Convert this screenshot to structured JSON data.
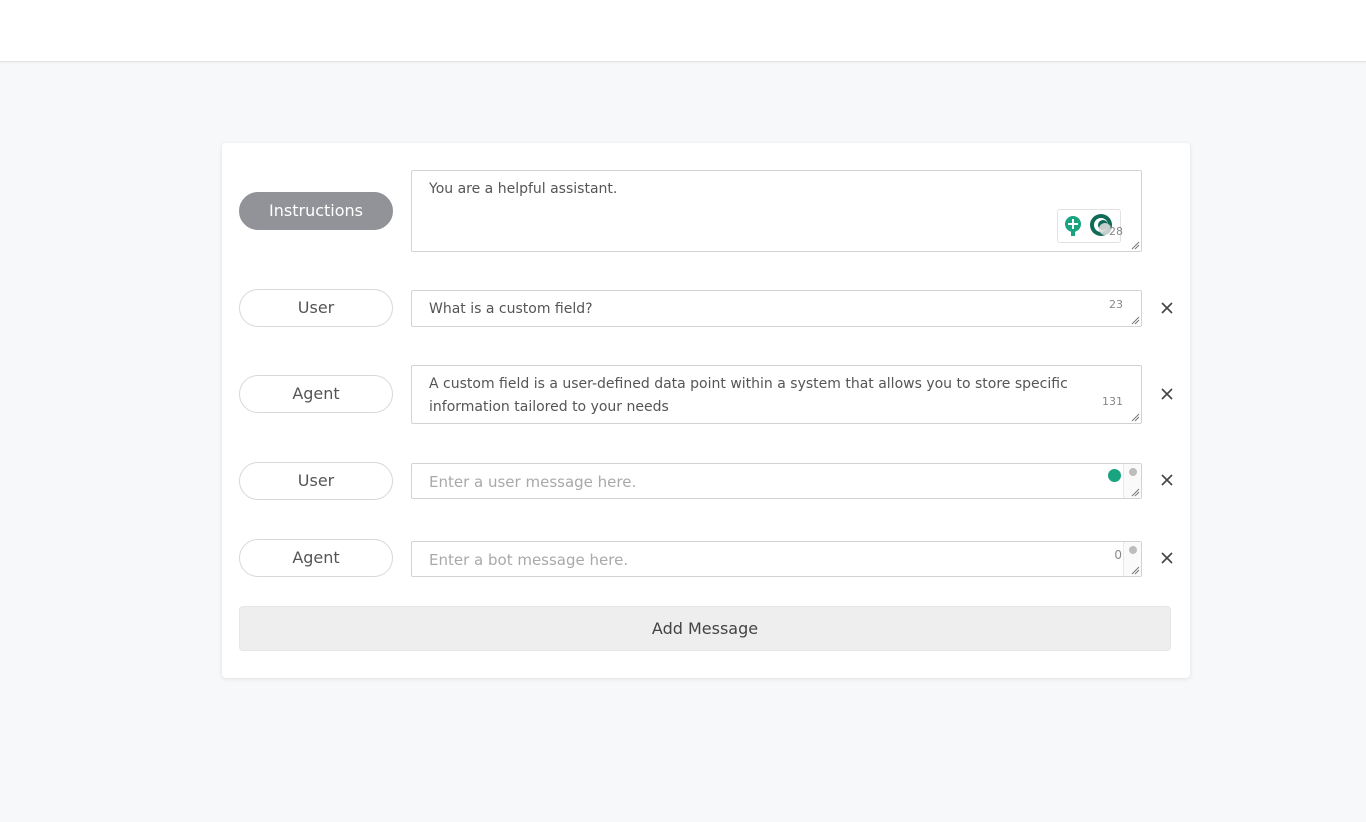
{
  "rows": [
    {
      "role_label": "Instructions",
      "value": "You are a helpful assistant.",
      "placeholder": "",
      "count": "28"
    },
    {
      "role_label": "User",
      "value": "What is a custom field?",
      "placeholder": "",
      "count": "23"
    },
    {
      "role_label": "Agent",
      "value": "A custom field is a user-defined data point within a system that allows you to store specific information tailored to your needs",
      "placeholder": "",
      "count": "131"
    },
    {
      "role_label": "User",
      "value": "",
      "placeholder": "Enter a user message here.",
      "count": ""
    },
    {
      "role_label": "Agent",
      "value": "",
      "placeholder": "Enter a bot message here.",
      "count": "0"
    }
  ],
  "add_message_label": "Add Message",
  "colors": {
    "active_pill": "#919398",
    "accent_green": "#1aa37f",
    "page_background": "#f7f8f9"
  },
  "icons": {
    "remove": "close-icon",
    "extension": "assistant-extension-icon",
    "resize": "resize-grip-icon"
  }
}
